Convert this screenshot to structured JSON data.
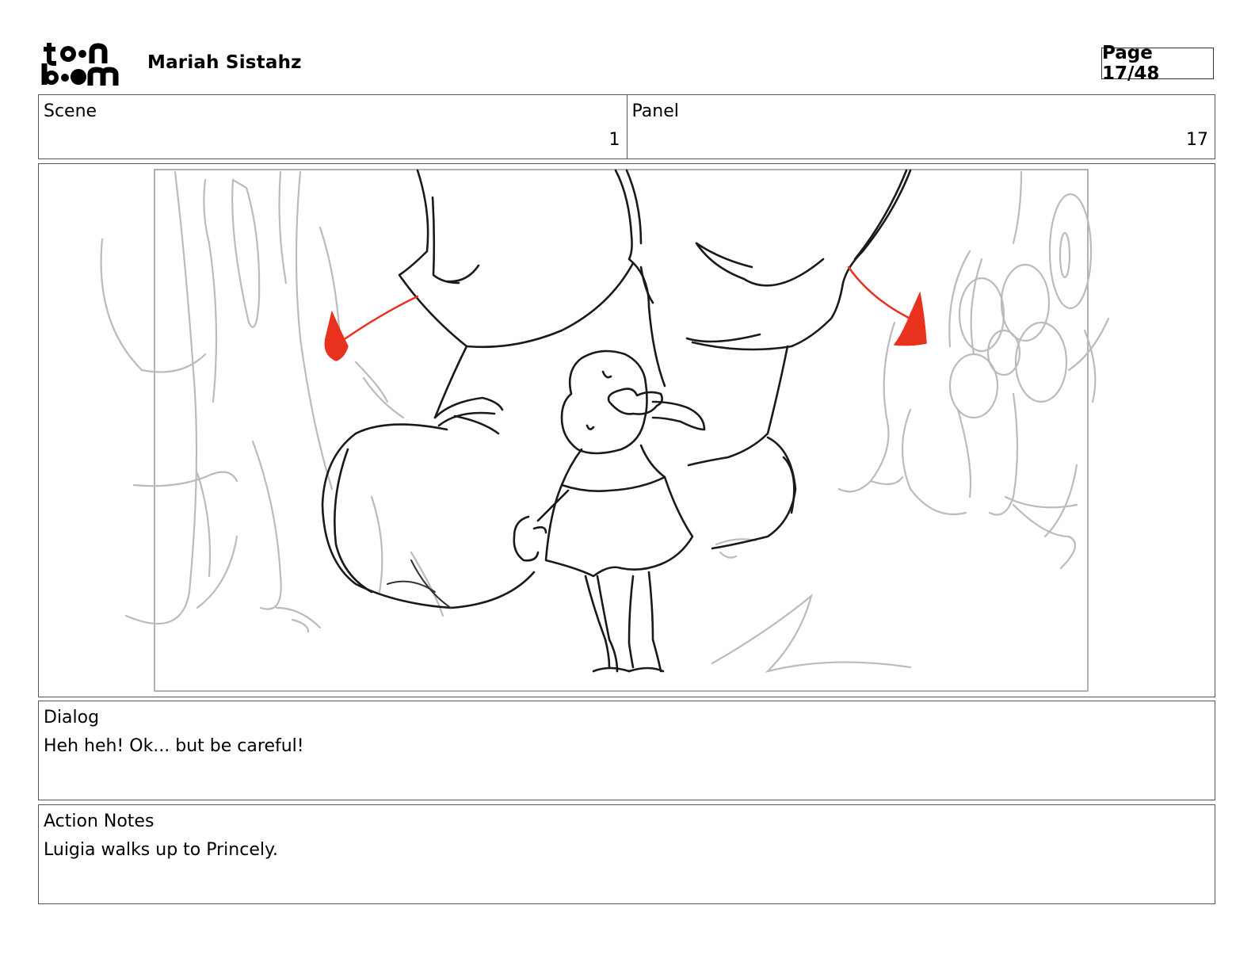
{
  "header": {
    "logo_line1": "toon",
    "logo_line2": "boom",
    "project_title": "Mariah Sistahz",
    "page_label": "Page 17/48"
  },
  "info": {
    "scene_label": "Scene",
    "scene_value": "1",
    "panel_label": "Panel",
    "panel_value": "17"
  },
  "panel_image": {
    "icon": "storyboard-sketch",
    "accent_color": "#e8321e",
    "line_color": "#1a1a1a",
    "background_line_color": "#b8b8b8"
  },
  "dialog": {
    "label": "Dialog",
    "text": "Heh heh! Ok... but be careful!"
  },
  "action_notes": {
    "label": "Action Notes",
    "text": "Luigia walks up to Princely."
  }
}
